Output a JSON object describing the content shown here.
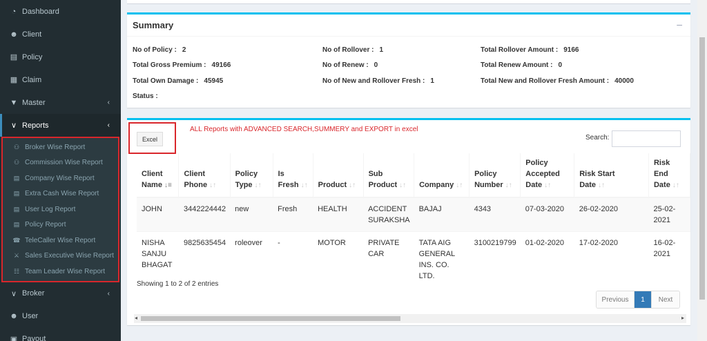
{
  "sidebar": {
    "items_top": [
      {
        "label": "Dashboard",
        "icon": "dashboard-icon",
        "glyph": "◔"
      },
      {
        "label": "Client",
        "icon": "user-icon",
        "glyph": "☻"
      },
      {
        "label": "Policy",
        "icon": "file-icon",
        "glyph": "▤"
      },
      {
        "label": "Claim",
        "icon": "calendar-icon",
        "glyph": "▦"
      },
      {
        "label": "Master",
        "icon": "shield-icon",
        "glyph": "▼",
        "chevron": "‹"
      }
    ],
    "reports": {
      "label": "Reports",
      "glyph": "∨",
      "chevron": "‹"
    },
    "submenu": [
      {
        "label": "Broker Wise Report",
        "glyph": "⚇"
      },
      {
        "label": "Commission Wise Report",
        "glyph": "⚇"
      },
      {
        "label": "Company Wise Report",
        "glyph": "▤"
      },
      {
        "label": "Extra Cash Wise Report",
        "glyph": "▤"
      },
      {
        "label": "User Log Report",
        "glyph": "▤"
      },
      {
        "label": "Policy Report",
        "glyph": "▤"
      },
      {
        "label": "TeleCaller Wise Report",
        "glyph": "☎"
      },
      {
        "label": "Sales Executive Wise Report",
        "glyph": "⚔"
      },
      {
        "label": "Team Leader Wise Report",
        "glyph": "☷"
      }
    ],
    "items_bottom": [
      {
        "label": "Broker",
        "glyph": "∨",
        "chevron": "‹"
      },
      {
        "label": "User",
        "glyph": "☻"
      },
      {
        "label": "Payout",
        "glyph": "▣"
      }
    ]
  },
  "summary": {
    "title": "Summary",
    "collapse": "–",
    "fields": [
      {
        "label": "No of Policy :",
        "value": "2"
      },
      {
        "label": "Total Gross Premium :",
        "value": "49166"
      },
      {
        "label": "Total Own Damage :",
        "value": "45945"
      },
      {
        "label": "Status :",
        "value": ""
      },
      {
        "label": "No of Rollover :",
        "value": "1"
      },
      {
        "label": "No of Renew :",
        "value": "0"
      },
      {
        "label": "No of New and Rollover Fresh :",
        "value": "1"
      },
      {
        "label": "Total Rollover Amount :",
        "value": "9166"
      },
      {
        "label": "Total Renew Amount :",
        "value": "0"
      },
      {
        "label": "Total New and Rollover Fresh Amount :",
        "value": "40000"
      }
    ]
  },
  "report": {
    "excel_label": "Excel",
    "note": "ALL Reports with ADVANCED SEARCH,SUMMERY and EXPORT in excel",
    "search_label": "Search:",
    "search_value": "",
    "columns": [
      [
        "Client",
        "Name"
      ],
      [
        "Client",
        "Phone"
      ],
      [
        "Policy",
        "Type"
      ],
      [
        "Is",
        "Fresh"
      ],
      [
        "Product",
        ""
      ],
      [
        "Sub",
        "Product"
      ],
      [
        "Company",
        ""
      ],
      [
        "Policy",
        "Number"
      ],
      [
        "Policy",
        "Accepted",
        "Date"
      ],
      [
        "Risk Start",
        "Date"
      ],
      [
        "Risk End",
        "Date"
      ]
    ],
    "rows": [
      [
        "JOHN",
        "3442224442",
        "new",
        "Fresh",
        "HEALTH",
        "ACCIDENT SURAKSHA",
        "BAJAJ",
        "4343",
        "07-03-2020",
        "26-02-2020",
        "25-02-2021"
      ],
      [
        "NISHA SANJU BHAGAT",
        "9825635454",
        "roleover",
        "-",
        "MOTOR",
        "PRIVATE CAR",
        "TATA AIG GENERAL INS. CO. LTD.",
        "3100219799",
        "01-02-2020",
        "17-02-2020",
        "16-02-2021"
      ]
    ],
    "showing": "Showing 1 to 2 of 2 entries",
    "pager": {
      "prev": "Previous",
      "current": "1",
      "next": "Next"
    }
  }
}
